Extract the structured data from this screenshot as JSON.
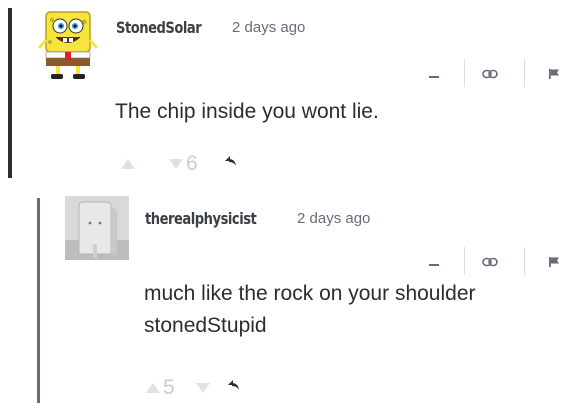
{
  "comments": [
    {
      "author": "StonedSolar",
      "timestamp": "2 days ago",
      "text": "The chip inside you wont lie.",
      "upvotes": "",
      "downvotes": "6",
      "avatar": "spongebob-avatar"
    },
    {
      "author": "therealphysicist",
      "timestamp": "2 days ago",
      "text": "much like the rock on your shoulder stonedStupid",
      "upvotes": "5",
      "downvotes": "",
      "avatar": "default-avatar"
    }
  ],
  "icons": {
    "collapse": "minus-icon",
    "link": "link-icon",
    "flag": "flag-icon",
    "upvote": "upvote-arrow-icon",
    "downvote": "downvote-arrow-icon",
    "reply": "reply-icon"
  },
  "colors": {
    "text": "#2a2e2e",
    "muted": "#656c7a",
    "vote": "#c2c6cc",
    "thread_bar_active": "#2e2e2e",
    "thread_bar_reply": "#656c7a"
  }
}
